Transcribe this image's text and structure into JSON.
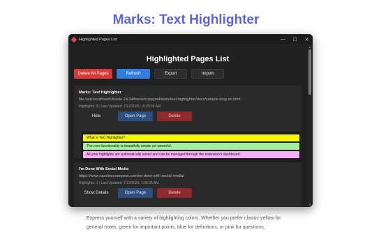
{
  "headline": "Marks: Text Highlighter",
  "window": {
    "title": "Highlighted Pages List",
    "controls": {
      "minimize": "—",
      "maximize": "☐",
      "close": "✕"
    }
  },
  "page": {
    "title": "Highlighted Pages List",
    "toolbar": {
      "delete_all": "Delete All Pages",
      "refresh": "Refresh",
      "export": "Export",
      "import": "Import"
    }
  },
  "cards": [
    {
      "title": "Marks: Text Highlighter",
      "url": "file://wsl.localhost/Ubuntu-24.04/home/cuspymd/work/text-highlighter/docs/sample-blog.en.html",
      "meta": "Highlights: 3 | Last Updated: 7/12/2025, 10:25:55 AM",
      "toggle_label": "Hide",
      "open_label": "Open Page",
      "delete_label": "Delete",
      "highlights": [
        {
          "text": "What is Text Highlighter?",
          "color": "#f7f700"
        },
        {
          "text": "The core functionality is beautifully simple yet powerful.",
          "color": "#a4f0a0"
        },
        {
          "text": "All your highlights are automatically saved and can be managed through the extension's dashboard.",
          "color": "#f7b0f5"
        }
      ]
    },
    {
      "title": "I'm Done With Social Media",
      "url": "https://www.carolinecrampton.com/im-done-with-social-media/",
      "meta": "Highlights: 1 | Last Updated: 7/12/2025, 1:08:35 AM",
      "toggle_label": "Show Details",
      "open_label": "Open Page",
      "delete_label": "Delete"
    }
  ],
  "description": "Express yourself with a variety of highlighting colors. Whether you prefer classic yellow for general notes, green for important points, blue for definitions, or pink for questions,"
}
